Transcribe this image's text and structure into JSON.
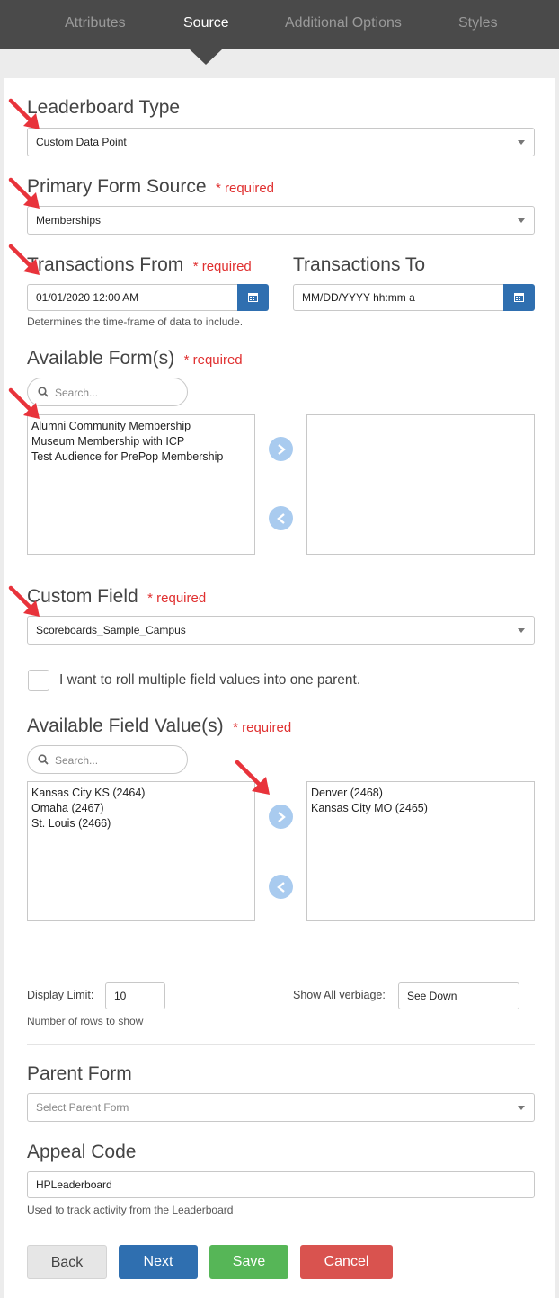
{
  "tabs": [
    "Attributes",
    "Source",
    "Additional Options",
    "Styles"
  ],
  "active_tab": "Source",
  "required_text": "* required",
  "leaderboard_type": {
    "label": "Leaderboard Type",
    "value": "Custom Data Point"
  },
  "primary_form_source": {
    "label": "Primary Form Source",
    "value": "Memberships"
  },
  "transactions_from": {
    "label": "Transactions From",
    "value": "01/01/2020 12:00 AM",
    "help": "Determines the time-frame of data to include."
  },
  "transactions_to": {
    "label": "Transactions To",
    "placeholder": "MM/DD/YYYY hh:mm a"
  },
  "available_forms": {
    "label": "Available Form(s)",
    "search_placeholder": "Search...",
    "items": [
      "Alumni Community Membership",
      "Museum Membership with ICP",
      "Test Audience for PrePop Membership"
    ]
  },
  "custom_field": {
    "label": "Custom Field",
    "value": "Scoreboards_Sample_Campus"
  },
  "roll_checkbox_label": "I want to roll multiple field values into one parent.",
  "available_field_values": {
    "label": "Available Field Value(s)",
    "search_placeholder": "Search...",
    "available": [
      "Kansas City KS (2464)",
      "Omaha (2467)",
      "St. Louis (2466)"
    ],
    "selected": [
      "Denver (2468)",
      "Kansas City MO (2465)"
    ]
  },
  "display_limit": {
    "label": "Display Limit:",
    "value": "10",
    "help": "Number of rows to show"
  },
  "show_all": {
    "label": "Show All verbiage:",
    "value": "See Down"
  },
  "parent_form": {
    "label": "Parent Form",
    "placeholder": "Select Parent Form"
  },
  "appeal_code": {
    "label": "Appeal Code",
    "value": "HPLeaderboard",
    "help": "Used to track activity from the Leaderboard"
  },
  "buttons": {
    "back": "Back",
    "next": "Next",
    "save": "Save",
    "cancel": "Cancel"
  },
  "colors": {
    "topbar": "#4a4a4a",
    "required": "#e03030",
    "primary": "#2f6fb0",
    "save": "#56b657",
    "cancel": "#d9534f",
    "arrow": "#e8333b"
  }
}
